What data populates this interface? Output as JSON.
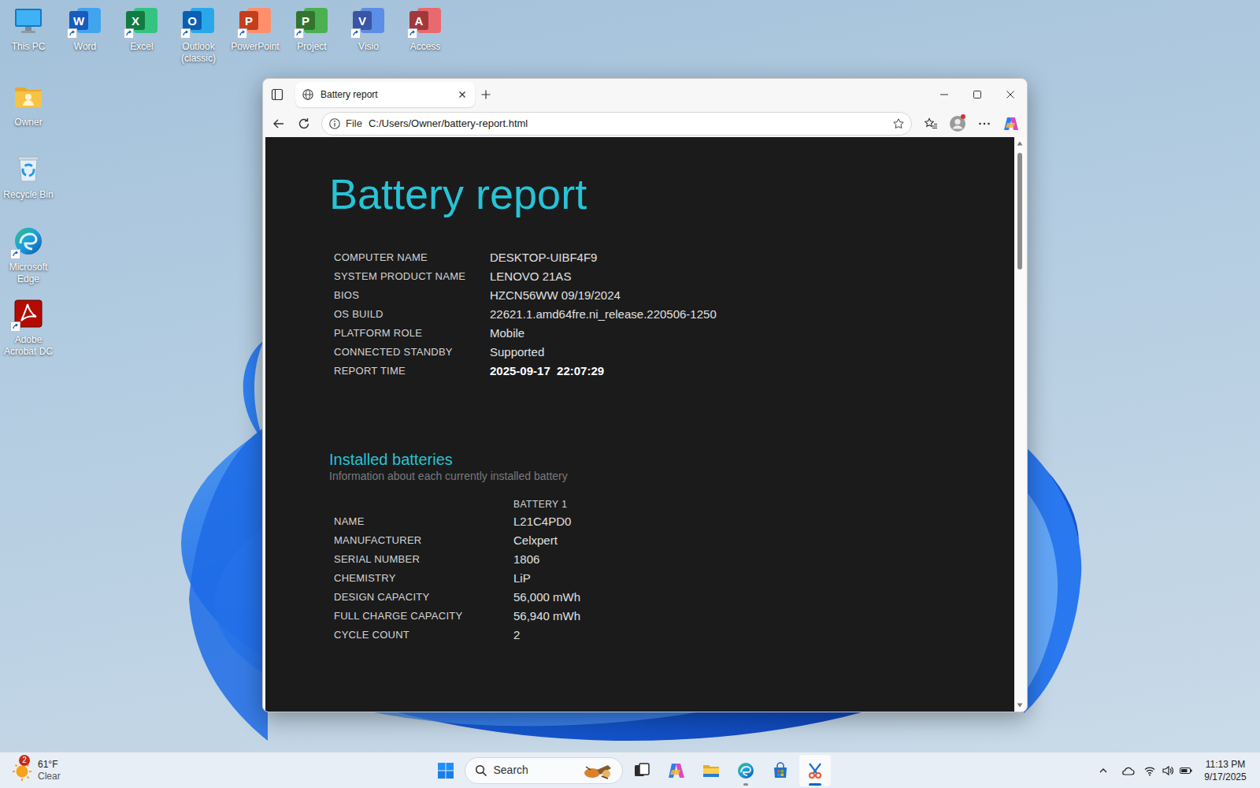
{
  "desktop": {
    "icons_row": [
      {
        "label": "This PC",
        "kind": "pc",
        "shortcut": false
      },
      {
        "label": "Word",
        "kind": "word",
        "glyph": "W",
        "shortcut": true
      },
      {
        "label": "Excel",
        "kind": "excel",
        "glyph": "X",
        "shortcut": true
      },
      {
        "label": "Outlook (classic)",
        "kind": "outlook",
        "glyph": "O",
        "shortcut": true
      },
      {
        "label": "PowerPoint",
        "kind": "powerpoint",
        "glyph": "P",
        "shortcut": true
      },
      {
        "label": "Project",
        "kind": "project",
        "glyph": "P",
        "shortcut": true
      },
      {
        "label": "Visio",
        "kind": "visio",
        "glyph": "V",
        "shortcut": true
      },
      {
        "label": "Access",
        "kind": "access",
        "glyph": "A",
        "shortcut": true
      }
    ],
    "icons_column": [
      {
        "label": "Owner",
        "kind": "folder",
        "shortcut": false
      },
      {
        "label": "Recycle Bin",
        "kind": "recycle",
        "shortcut": false
      },
      {
        "label": "Microsoft Edge",
        "kind": "edge",
        "shortcut": true
      },
      {
        "label": "Adobe Acrobat DC",
        "kind": "acrobat",
        "shortcut": true
      }
    ]
  },
  "browser": {
    "tab": {
      "title": "Battery report",
      "selected": true
    },
    "address": {
      "scheme": "File",
      "url": "C:/Users/Owner/battery-report.html"
    },
    "profile_notification": true
  },
  "report": {
    "title": "Battery report",
    "info": [
      {
        "label": "COMPUTER NAME",
        "value": "DESKTOP-UIBF4F9",
        "bold": false
      },
      {
        "label": "SYSTEM PRODUCT NAME",
        "value": "LENOVO 21AS",
        "bold": false
      },
      {
        "label": "BIOS",
        "value": "HZCN56WW 09/19/2024",
        "bold": false
      },
      {
        "label": "OS BUILD",
        "value": "22621.1.amd64fre.ni_release.220506-1250",
        "bold": false
      },
      {
        "label": "PLATFORM ROLE",
        "value": "Mobile",
        "bold": false
      },
      {
        "label": "CONNECTED STANDBY",
        "value": "Supported",
        "bold": false
      },
      {
        "label": "REPORT TIME",
        "value": "2025-09-17  22:07:29",
        "bold": true
      }
    ],
    "installed_batteries": {
      "heading": "Installed batteries",
      "subtitle": "Information about each currently installed battery",
      "columns": [
        "BATTERY 1"
      ],
      "rows": [
        {
          "label": "NAME",
          "values": [
            "L21C4PD0"
          ]
        },
        {
          "label": "MANUFACTURER",
          "values": [
            "Celxpert"
          ]
        },
        {
          "label": "SERIAL NUMBER",
          "values": [
            "1806"
          ]
        },
        {
          "label": "CHEMISTRY",
          "values": [
            "LiP"
          ]
        },
        {
          "label": "DESIGN CAPACITY",
          "values": [
            "56,000 mWh"
          ]
        },
        {
          "label": "FULL CHARGE CAPACITY",
          "values": [
            "56,940 mWh"
          ]
        },
        {
          "label": "CYCLE COUNT",
          "values": [
            "2"
          ]
        }
      ]
    }
  },
  "taskbar": {
    "weather": {
      "badge": "2",
      "temperature": "61°F",
      "condition": "Clear"
    },
    "search": {
      "placeholder": "Search"
    },
    "apps": [
      {
        "kind": "taskview",
        "running": false,
        "active": false
      },
      {
        "kind": "copilot",
        "running": false,
        "active": false
      },
      {
        "kind": "explorer",
        "running": false,
        "active": false
      },
      {
        "kind": "edge",
        "running": true,
        "active": false
      },
      {
        "kind": "store",
        "running": false,
        "active": false
      },
      {
        "kind": "snipping",
        "running": true,
        "active": true
      }
    ],
    "tray": {
      "battery_level": 0.75
    },
    "clock": {
      "time": "11:13 PM",
      "date": "9/17/2025"
    }
  }
}
